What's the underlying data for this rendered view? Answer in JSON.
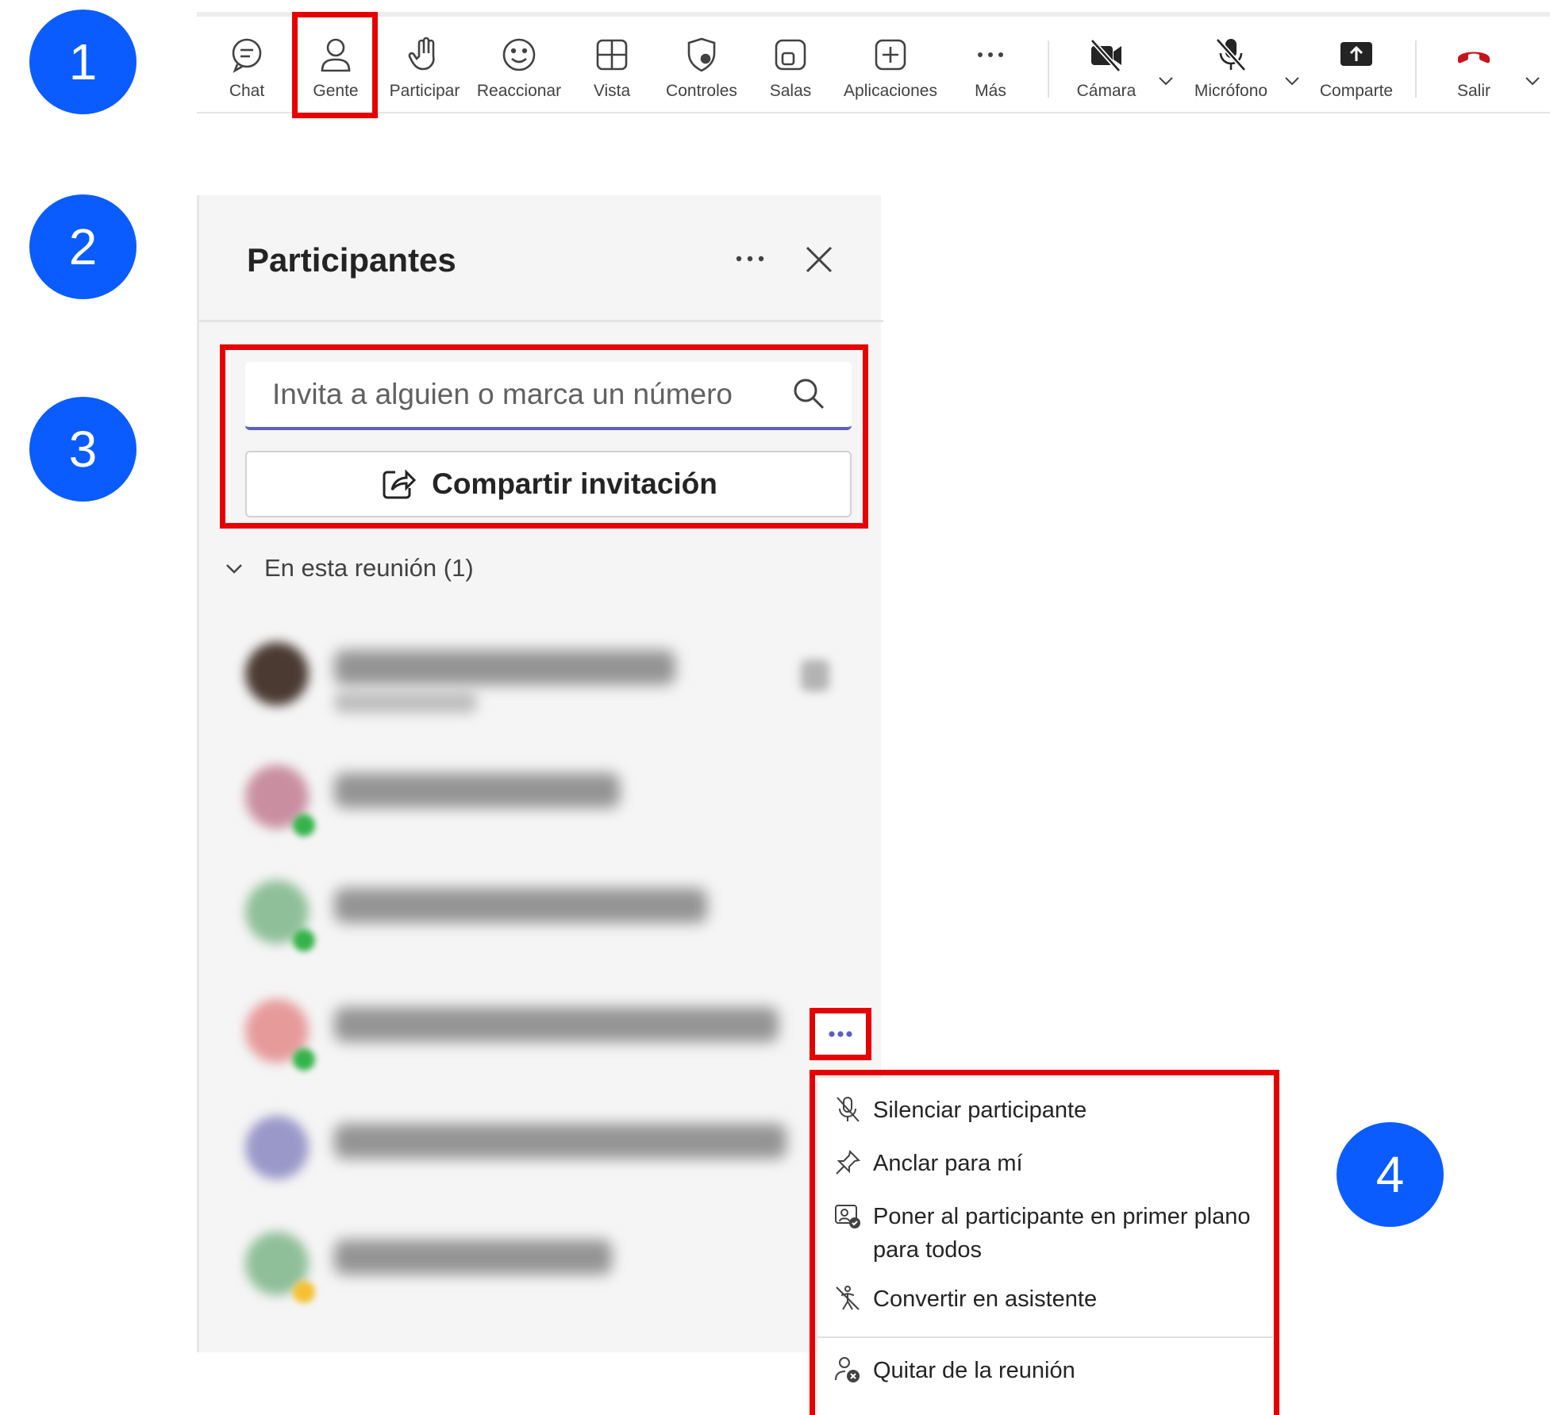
{
  "steps": [
    "1",
    "2",
    "3",
    "4"
  ],
  "toolbar": {
    "items": [
      {
        "label": "Chat",
        "icon": "chat-icon"
      },
      {
        "label": "Gente",
        "icon": "people-icon"
      },
      {
        "label": "Participar",
        "icon": "raise-hand-icon"
      },
      {
        "label": "Reaccionar",
        "icon": "smiley-icon"
      },
      {
        "label": "Vista",
        "icon": "grid-view-icon"
      },
      {
        "label": "Controles",
        "icon": "shield-gear-icon"
      },
      {
        "label": "Salas",
        "icon": "rooms-icon"
      },
      {
        "label": "Aplicaciones",
        "icon": "add-app-icon"
      },
      {
        "label": "Más",
        "icon": "more-icon"
      },
      {
        "label": "Cámara",
        "icon": "camera-off-icon"
      },
      {
        "label": "Micrófono",
        "icon": "mic-off-icon"
      },
      {
        "label": "Comparte",
        "icon": "share-screen-icon"
      },
      {
        "label": "Salir",
        "icon": "hang-up-icon"
      }
    ]
  },
  "panel": {
    "title": "Participantes",
    "search_placeholder": "Invita a alguien o marca un número",
    "share_label": "Compartir invitación",
    "section_label": "En esta reunión (1)"
  },
  "menu": {
    "items": [
      {
        "label": "Silenciar participante",
        "icon": "mic-off-icon"
      },
      {
        "label": "Anclar para mí",
        "icon": "pin-icon"
      },
      {
        "label": "Poner al participante en primer plano",
        "label2": "para todos",
        "icon": "spotlight-icon"
      },
      {
        "label": "Convertir en asistente",
        "icon": "attendee-icon"
      },
      {
        "label": "Quitar de la reunión",
        "icon": "remove-person-icon"
      }
    ]
  },
  "colors": {
    "step_marker": "#0a5cff",
    "highlight": "#e60000",
    "accent": "#5b5fc7",
    "hang_up": "#c4141d",
    "panel_bg": "#f5f5f5"
  }
}
